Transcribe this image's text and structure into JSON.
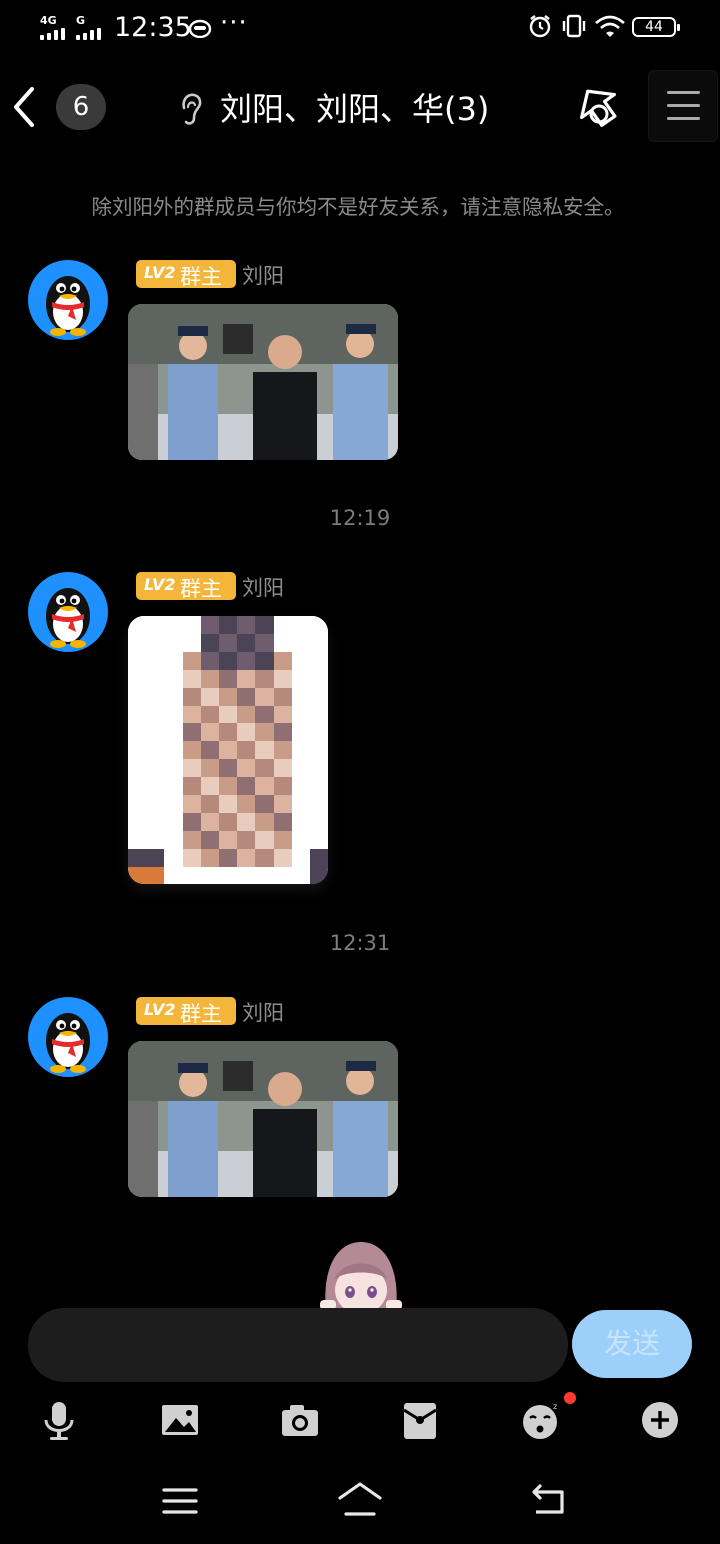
{
  "status_bar": {
    "sim1": "4G",
    "sim2": "G",
    "time": "12:35",
    "more": "···",
    "battery": "44"
  },
  "header": {
    "unread_count": "6",
    "title": "刘阳、刘阳、华(3)",
    "icons": [
      "back-arrow-icon",
      "ear-icon",
      "phone-call-icon",
      "menu-icon"
    ]
  },
  "notice": "除刘阳外的群成员与你均不是好友关系，请注意隐私安全。",
  "messages": [
    {
      "level": "LV2",
      "role": "群主",
      "sender": "刘阳",
      "type": "photo"
    },
    {
      "level": "LV2",
      "role": "群主",
      "sender": "刘阳",
      "type": "mosaic-photo"
    },
    {
      "level": "LV2",
      "role": "群主",
      "sender": "刘阳",
      "type": "photo"
    }
  ],
  "timestamps": [
    "12:19",
    "12:31"
  ],
  "input": {
    "placeholder": "",
    "send_label": "发送"
  },
  "toolbar": [
    "microphone-icon",
    "image-icon",
    "camera-icon",
    "red-packet-icon",
    "emoji-icon",
    "plus-icon"
  ],
  "colors": {
    "background": "#000000",
    "level_tag": "#f3b63a",
    "send_button": "#9cd0fb",
    "notification_dot": "#ff3b30"
  }
}
